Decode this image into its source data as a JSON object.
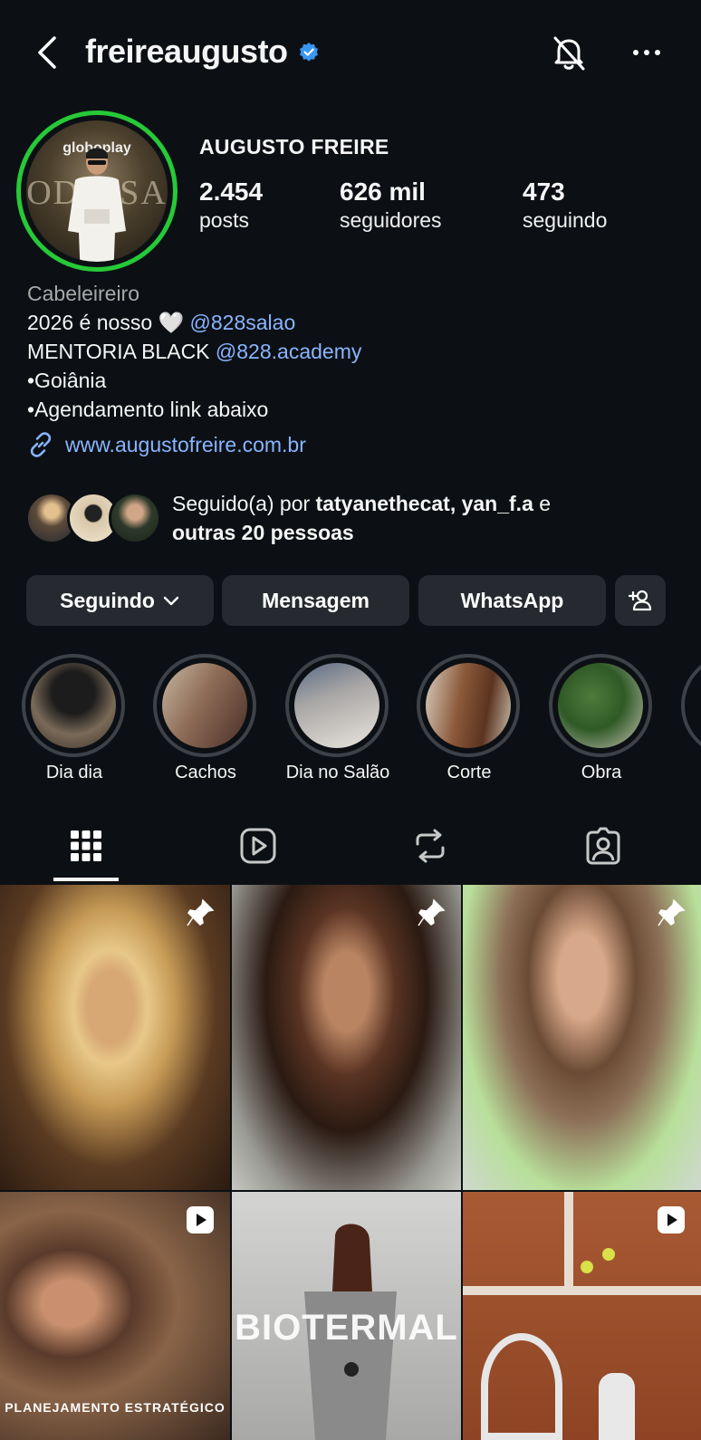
{
  "header": {
    "username": "freireaugusto",
    "icons": [
      "back-icon",
      "verified-badge-icon",
      "bell-off-icon",
      "more-icon"
    ]
  },
  "profile": {
    "full_name": "AUGUSTO FREIRE",
    "avatar_text": {
      "logo": "globoplay",
      "word": "ODIOSA"
    },
    "stats": [
      {
        "value": "2.454",
        "label": "posts"
      },
      {
        "value": "626 mil",
        "label": "seguidores"
      },
      {
        "value": "473",
        "label": "seguindo"
      }
    ],
    "category": "Cabeleireiro",
    "bio": {
      "line1_text": "2026 é nosso 🤍 ",
      "line1_mention": "@828salao",
      "line2_text": "MENTORIA BLACK ",
      "line2_mention": "@828.academy",
      "line3": "•Goiânia",
      "line4": "•Agendamento link abaixo"
    },
    "link": "www.augustofreire.com.br",
    "followed_by": {
      "prefix": "Seguido(a) por ",
      "names": "tatyanethecat, yan_f.a",
      "conj": " e",
      "others": "outras 20 pessoas"
    }
  },
  "actions": {
    "following": "Seguindo",
    "message": "Mensagem",
    "whatsapp": "WhatsApp",
    "add_user_icon": "add-person-icon"
  },
  "highlights": [
    {
      "label": "Dia dia"
    },
    {
      "label": "Cachos"
    },
    {
      "label": "Dia no Salão"
    },
    {
      "label": "Corte"
    },
    {
      "label": "Obra"
    }
  ],
  "tabs": [
    "grid-icon",
    "reels-icon",
    "reposts-icon",
    "tagged-icon"
  ],
  "grid": {
    "posts": [
      {
        "badge": "pin-icon"
      },
      {
        "badge": "pin-icon"
      },
      {
        "badge": "pin-icon"
      },
      {
        "badge": "reel-icon",
        "text": "PLANEJAMENTO ESTRATÉGICO"
      },
      {
        "badge": "",
        "text": "BIOTERMAL"
      },
      {
        "badge": "reel-icon"
      }
    ]
  },
  "colors": {
    "background": "#0c1014",
    "button": "#262a30",
    "link": "#8ab4ff",
    "story_ring": "#26c937",
    "verified": "#3897f0"
  }
}
